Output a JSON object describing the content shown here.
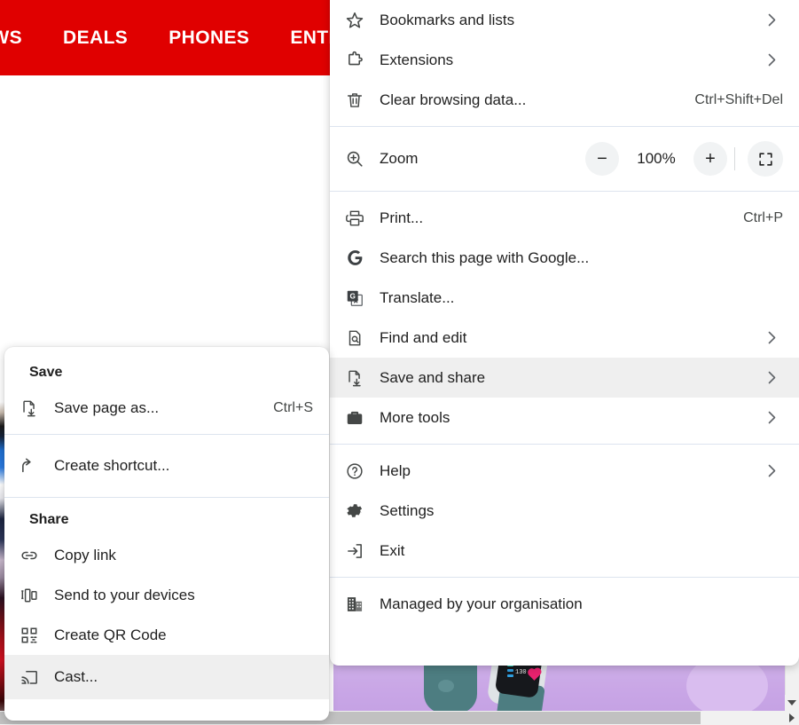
{
  "background": {
    "navbar": {
      "items": [
        "EWS",
        "DEALS",
        "PHONES",
        "ENTERTA"
      ],
      "bg_color": "#e00000",
      "text_color": "#ffffff"
    },
    "hero": {
      "bpm_text": "130"
    }
  },
  "main_menu": {
    "highlight_color": "#efefef",
    "separator_color": "#dde4ef",
    "groups": [
      {
        "items": [
          {
            "label": "Bookmarks and lists",
            "icon": "star-icon",
            "accel": "",
            "submenu": true
          },
          {
            "label": "Extensions",
            "icon": "puzzle-icon",
            "accel": "",
            "submenu": true
          },
          {
            "label": "Clear browsing data...",
            "icon": "trash-icon",
            "accel": "Ctrl+Shift+Del",
            "submenu": false
          }
        ]
      },
      {
        "zoom_row": {
          "label": "Zoom",
          "icon": "zoom-in-magnifier-icon",
          "decrease_label": "−",
          "value": "100%",
          "increase_label": "+",
          "fullscreen_label": "fullscreen-icon"
        }
      },
      {
        "items": [
          {
            "label": "Print...",
            "icon": "printer-icon",
            "accel": "Ctrl+P",
            "submenu": false
          },
          {
            "label": "Search this page with Google...",
            "icon": "google-g-icon",
            "accel": "",
            "submenu": false
          },
          {
            "label": "Translate...",
            "icon": "google-translate-icon",
            "accel": "",
            "submenu": false
          },
          {
            "label": "Find and edit",
            "icon": "find-page-icon",
            "accel": "",
            "submenu": true
          },
          {
            "label": "Save and share",
            "icon": "save-share-icon",
            "accel": "",
            "submenu": true,
            "highlighted": true
          },
          {
            "label": "More tools",
            "icon": "toolbox-icon",
            "accel": "",
            "submenu": true
          }
        ]
      },
      {
        "items": [
          {
            "label": "Help",
            "icon": "help-circle-icon",
            "accel": "",
            "submenu": true
          },
          {
            "label": "Settings",
            "icon": "gear-icon",
            "accel": "",
            "submenu": false
          },
          {
            "label": "Exit",
            "icon": "exit-arrow-icon",
            "accel": "",
            "submenu": false
          }
        ]
      },
      {
        "items": [
          {
            "label": "Managed by your organisation",
            "icon": "building-icon",
            "accel": "",
            "submenu": false
          }
        ]
      }
    ]
  },
  "sub_menu": {
    "title": "save-and-share-submenu",
    "save_heading": "Save",
    "share_heading": "Share",
    "save_items": [
      {
        "label": "Save page as...",
        "icon": "save-page-icon",
        "accel": "Ctrl+S"
      }
    ],
    "shortcut_items": [
      {
        "label": "Create shortcut...",
        "icon": "shortcut-arrow-icon",
        "accel": ""
      }
    ],
    "share_items": [
      {
        "label": "Copy link",
        "icon": "link-icon",
        "accel": ""
      },
      {
        "label": "Send to your devices",
        "icon": "devices-icon",
        "accel": ""
      },
      {
        "label": "Create QR Code",
        "icon": "qr-code-icon",
        "accel": ""
      },
      {
        "label": "Cast...",
        "icon": "cast-icon",
        "accel": "",
        "highlighted": true
      }
    ]
  }
}
